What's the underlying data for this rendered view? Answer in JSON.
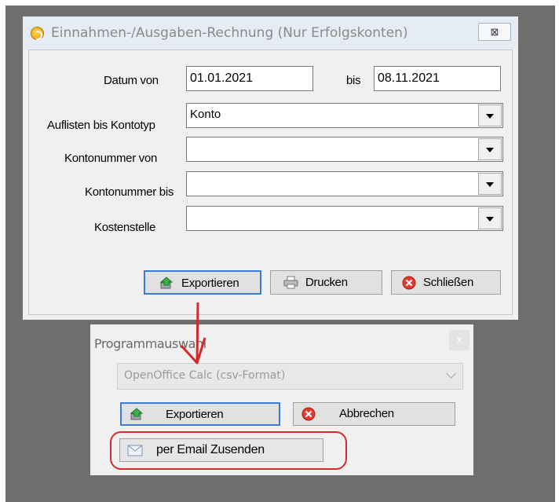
{
  "dialog_main": {
    "title": "Einnahmen-/Ausgaben-Rechnung (Nur Erfolgskonten)",
    "close_glyph": "⊠",
    "fields": {
      "datum_von_label": "Datum von",
      "datum_von_value": "01.01.2021",
      "bis_label": "bis",
      "bis_value": "08.11.2021",
      "kontotyp_label": "Auflisten bis Kontotyp",
      "kontotyp_value": "Konto",
      "kontonummer_von_label": "Kontonummer von",
      "kontonummer_von_value": "",
      "kontonummer_bis_label": "Kontonummer bis",
      "kontonummer_bis_value": "",
      "kostenstelle_label": "Kostenstelle",
      "kostenstelle_value": ""
    },
    "buttons": {
      "export": "Exportieren",
      "print": "Drucken",
      "close": "Schließen"
    }
  },
  "dialog_program": {
    "title": "Programmauswahl",
    "close_glyph": "x",
    "program_selected": "OpenOffice Calc (csv-Format)",
    "buttons": {
      "export": "Exportieren",
      "cancel": "Abbrechen",
      "email": "per Email Zusenden"
    }
  },
  "colors": {
    "annotation_red": "#d42a2a",
    "focus_blue": "#3a7bd5"
  },
  "icons": {
    "app": "app-c-icon",
    "export": "export-green-arrow-icon",
    "print": "printer-icon",
    "close": "red-x-circle-icon",
    "email": "envelope-icon"
  }
}
